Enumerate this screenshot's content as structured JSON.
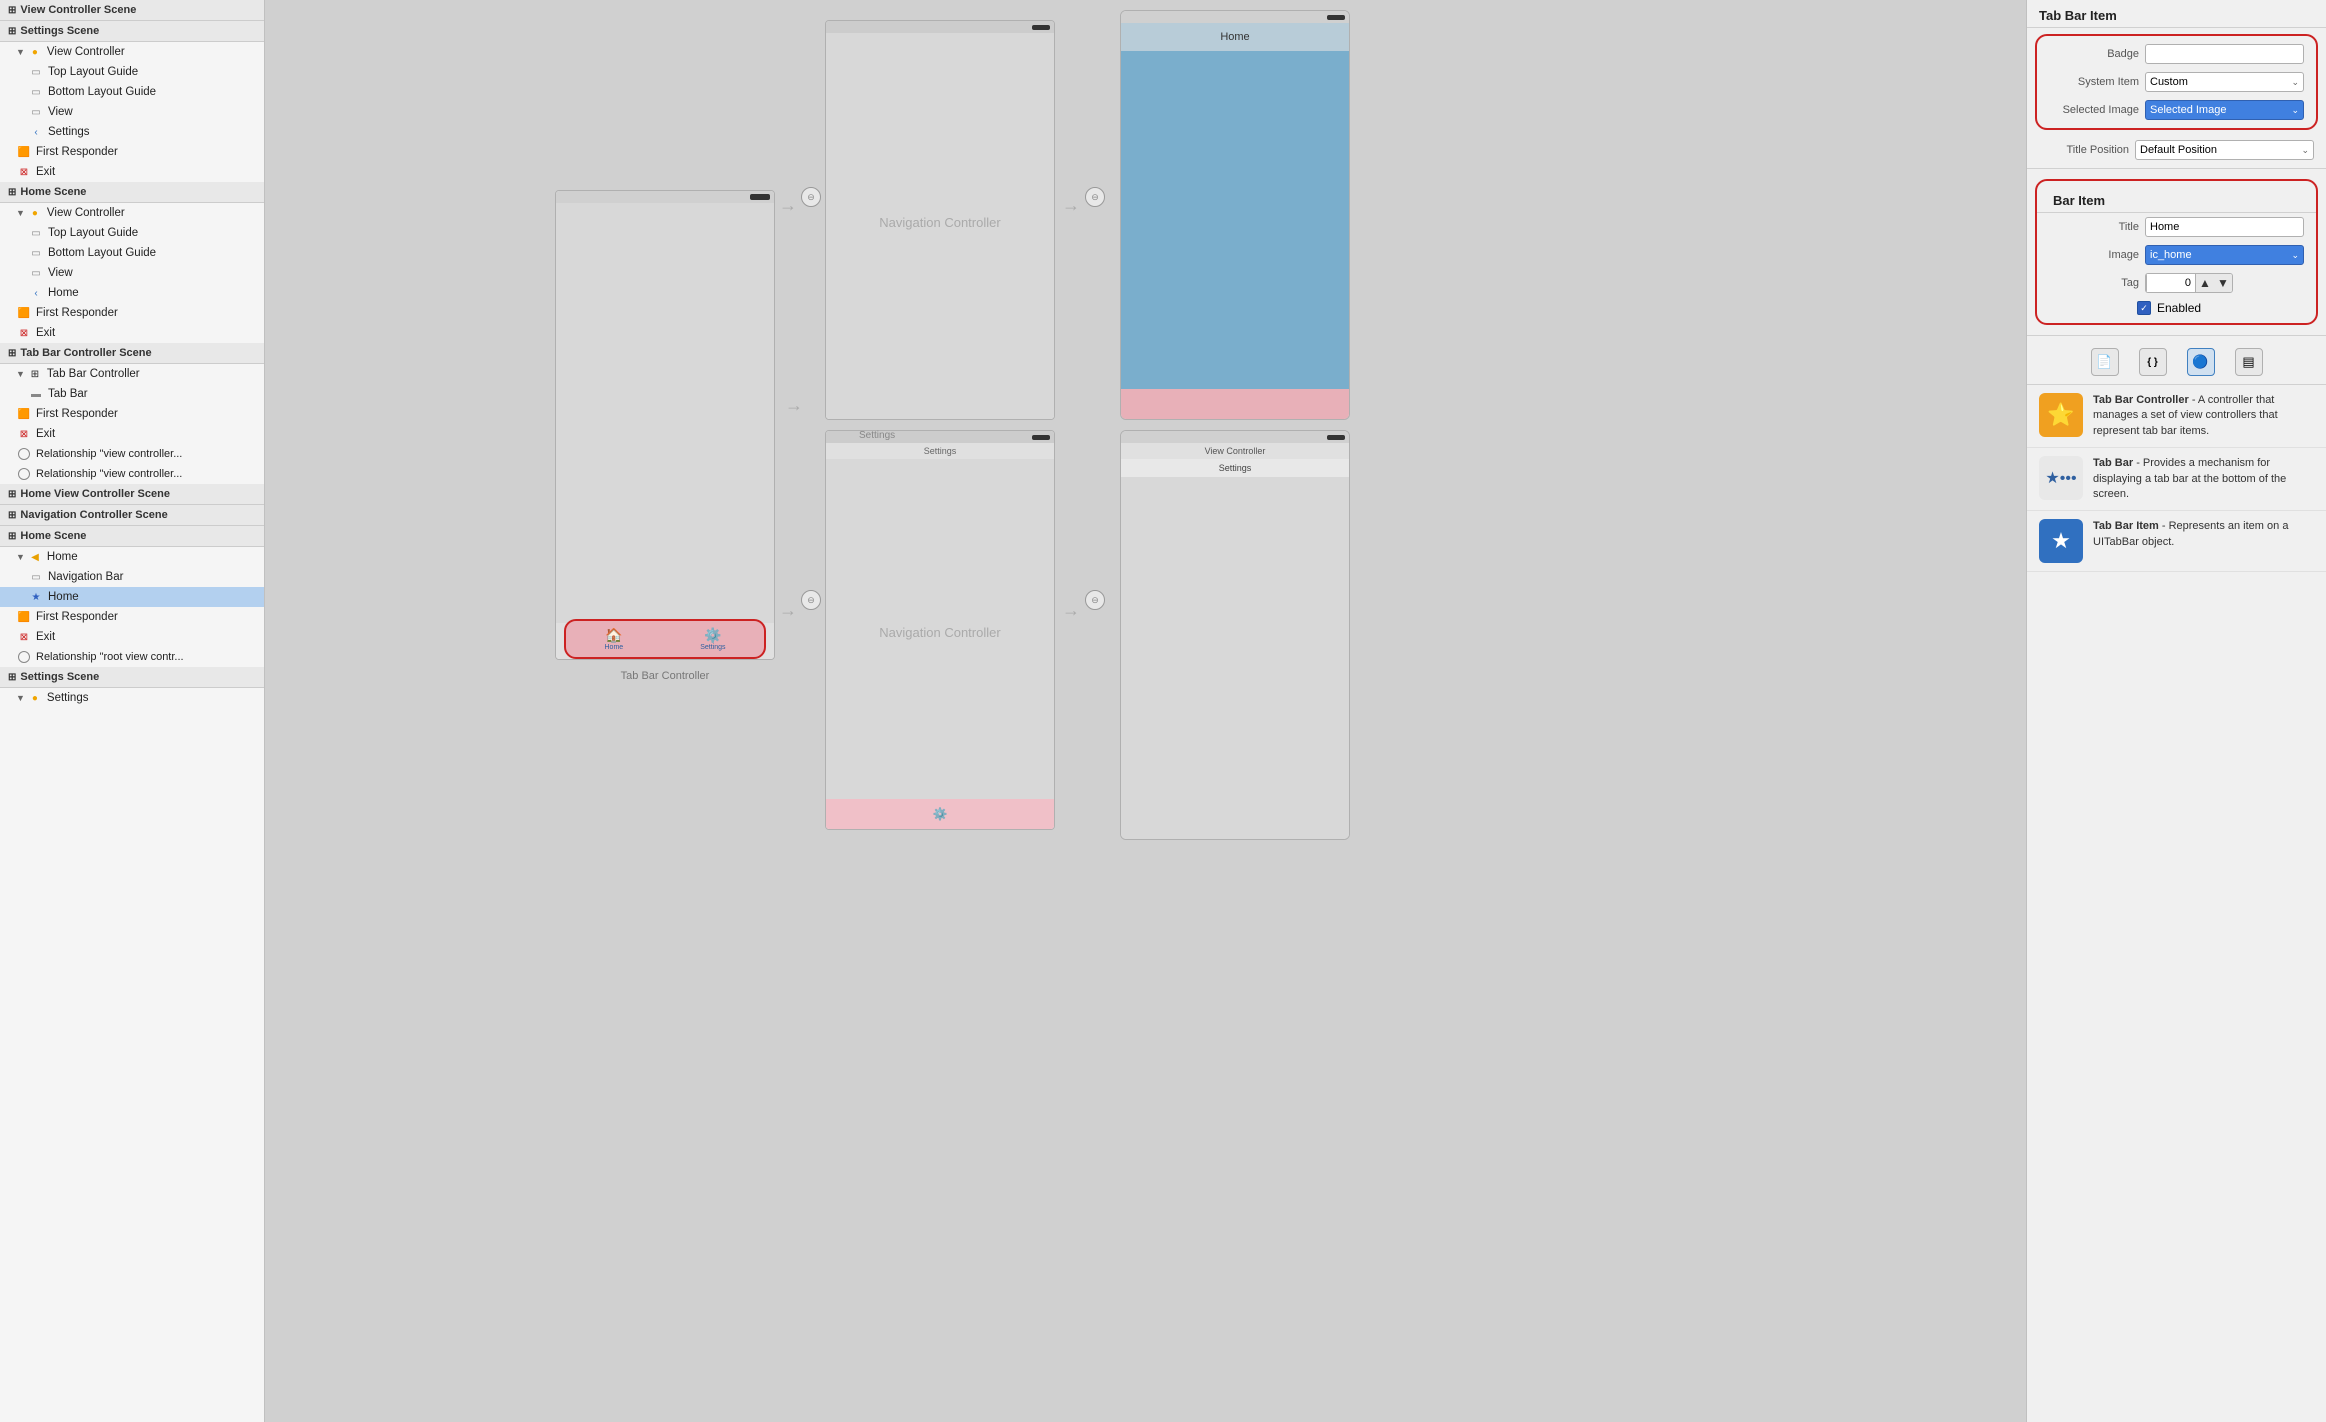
{
  "sidebar": {
    "sections": [
      {
        "name": "View Controller Scene",
        "level": 0,
        "items": []
      },
      {
        "name": "Settings Scene",
        "level": 0,
        "items": [
          {
            "label": "View Controller",
            "indent": 1,
            "icon": "yellow-circle",
            "arrow": "▼"
          },
          {
            "label": "Top Layout Guide",
            "indent": 2,
            "icon": "rect-gray"
          },
          {
            "label": "Bottom Layout Guide",
            "indent": 2,
            "icon": "rect-gray"
          },
          {
            "label": "View",
            "indent": 2,
            "icon": "rect-gray"
          },
          {
            "label": "Settings",
            "indent": 2,
            "icon": "back-blue"
          },
          {
            "label": "First Responder",
            "indent": 1,
            "icon": "orange-cube"
          },
          {
            "label": "Exit",
            "indent": 1,
            "icon": "red-exit"
          }
        ]
      },
      {
        "name": "Home Scene",
        "level": 0,
        "items": [
          {
            "label": "View Controller",
            "indent": 1,
            "icon": "yellow-circle",
            "arrow": "▼"
          },
          {
            "label": "Top Layout Guide",
            "indent": 2,
            "icon": "rect-gray"
          },
          {
            "label": "Bottom Layout Guide",
            "indent": 2,
            "icon": "rect-gray"
          },
          {
            "label": "View",
            "indent": 2,
            "icon": "rect-gray"
          },
          {
            "label": "Home",
            "indent": 2,
            "icon": "back-blue"
          },
          {
            "label": "First Responder",
            "indent": 1,
            "icon": "orange-cube"
          },
          {
            "label": "Exit",
            "indent": 1,
            "icon": "red-exit"
          }
        ]
      },
      {
        "name": "Tab Bar Controller Scene",
        "level": 0,
        "items": [
          {
            "label": "Tab Bar Controller",
            "indent": 1,
            "icon": "tab-bar-icon",
            "arrow": "▼"
          },
          {
            "label": "Tab Bar",
            "indent": 2,
            "icon": "tabbar-gray"
          },
          {
            "label": "First Responder",
            "indent": 1,
            "icon": "orange-cube"
          },
          {
            "label": "Exit",
            "indent": 1,
            "icon": "red-exit"
          },
          {
            "label": "Relationship \"view controller...",
            "indent": 1,
            "icon": "circle-outline"
          },
          {
            "label": "Relationship \"view controller...",
            "indent": 1,
            "icon": "circle-outline"
          }
        ]
      },
      {
        "name": "Home View Controller Scene",
        "level": 0,
        "items": []
      },
      {
        "name": "Navigation Controller Scene",
        "level": 0,
        "items": []
      },
      {
        "name": "Home Scene",
        "level": 0,
        "items": [
          {
            "label": "Home",
            "indent": 1,
            "icon": "yellow-circle-back",
            "arrow": "▼"
          },
          {
            "label": "Navigation Bar",
            "indent": 2,
            "icon": "rect-gray"
          },
          {
            "label": "Home",
            "indent": 2,
            "icon": "star-blue",
            "selected": true
          },
          {
            "label": "First Responder",
            "indent": 1,
            "icon": "orange-cube"
          },
          {
            "label": "Exit",
            "indent": 1,
            "icon": "red-exit"
          },
          {
            "label": "Relationship \"root view contr...",
            "indent": 1,
            "icon": "circle-outline"
          }
        ]
      },
      {
        "name": "Settings Scene",
        "level": 0,
        "items": [
          {
            "label": "Settings",
            "indent": 1,
            "icon": "yellow-circle",
            "arrow": "▼"
          }
        ]
      }
    ]
  },
  "canvas": {
    "tab_bar_controller_label": "Tab Bar Controller",
    "navigation_controller_label_1": "Navigation Controller",
    "navigation_controller_label_2": "Navigation Controller",
    "home_phone": {
      "nav_title": "Home",
      "tab_items": [
        {
          "label": "Home",
          "icon": "🏠"
        }
      ]
    },
    "settings_phone": {
      "nav_title": "Settings",
      "tab_items": [
        {
          "label": "Settings",
          "icon": "⚙️"
        }
      ]
    },
    "view_controller_phone": {
      "nav_title": "Home",
      "has_blue_content": true
    },
    "view_controller_phone2": {
      "nav_title": "Settings"
    }
  },
  "right_panel": {
    "tab_bar_item_title": "Tab Bar Item",
    "badge_label": "Badge",
    "system_item_label": "System Item",
    "system_item_value": "Custom",
    "selected_image_label": "Selected Image",
    "selected_image_placeholder": "Selected Image",
    "title_position_label": "Title Position",
    "title_position_value": "Default Position",
    "bar_item_title": "Bar Item",
    "title_label": "Title",
    "title_value": "Home",
    "image_label": "Image",
    "image_value": "ic_home",
    "tag_label": "Tag",
    "tag_value": "0",
    "enabled_label": "Enabled",
    "bottom_tabs": [
      {
        "icon": "📄",
        "label": "file-icon"
      },
      {
        "icon": "{ }",
        "label": "code-icon"
      },
      {
        "icon": "🔵",
        "label": "circle-icon",
        "active": true
      },
      {
        "icon": "▤",
        "label": "table-icon"
      }
    ],
    "help_items": [
      {
        "icon": "⭐",
        "icon_bg": "#f0a020",
        "title": "Tab Bar Controller",
        "description": " - A controller that manages a set of view controllers that represent tab bar items."
      },
      {
        "icon": "★",
        "icon_bg": "#e8e8e8",
        "title": "Tab Bar",
        "description": " - Provides a mechanism for displaying a tab bar at the bottom of the screen."
      },
      {
        "icon": "★",
        "icon_bg": "#3070c0",
        "title": "Tab Bar Item",
        "description": " - Represents an item on a UITabBar object."
      }
    ]
  }
}
